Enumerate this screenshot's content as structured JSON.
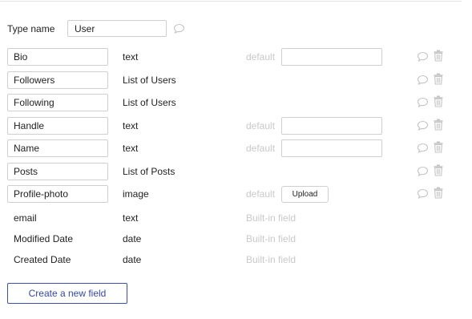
{
  "type_name": {
    "label": "Type name",
    "value": "User"
  },
  "fields": [
    {
      "name": "Bio",
      "type": "text",
      "default_label": "default"
    },
    {
      "name": "Followers",
      "type": "List of Users"
    },
    {
      "name": "Following",
      "type": "List of Users"
    },
    {
      "name": "Handle",
      "type": "text",
      "default_label": "default"
    },
    {
      "name": "Name",
      "type": "text",
      "default_label": "default"
    },
    {
      "name": "Posts",
      "type": "List of Posts"
    },
    {
      "name": "Profile-photo",
      "type": "image",
      "default_label": "default",
      "upload_label": "Upload"
    }
  ],
  "builtin_fields": [
    {
      "name": "email",
      "type": "text",
      "label": "Built-in field"
    },
    {
      "name": "Modified Date",
      "type": "date",
      "label": "Built-in field"
    },
    {
      "name": "Created Date",
      "type": "date",
      "label": "Built-in field"
    }
  ],
  "create_button_label": "Create a new field",
  "icons": {
    "comment": "speech-bubble-icon",
    "delete": "trash-icon"
  },
  "colors": {
    "accent": "#3548a8",
    "muted": "#c9c9c9",
    "border": "#cfcfcf",
    "icon": "#c4c4c4"
  }
}
